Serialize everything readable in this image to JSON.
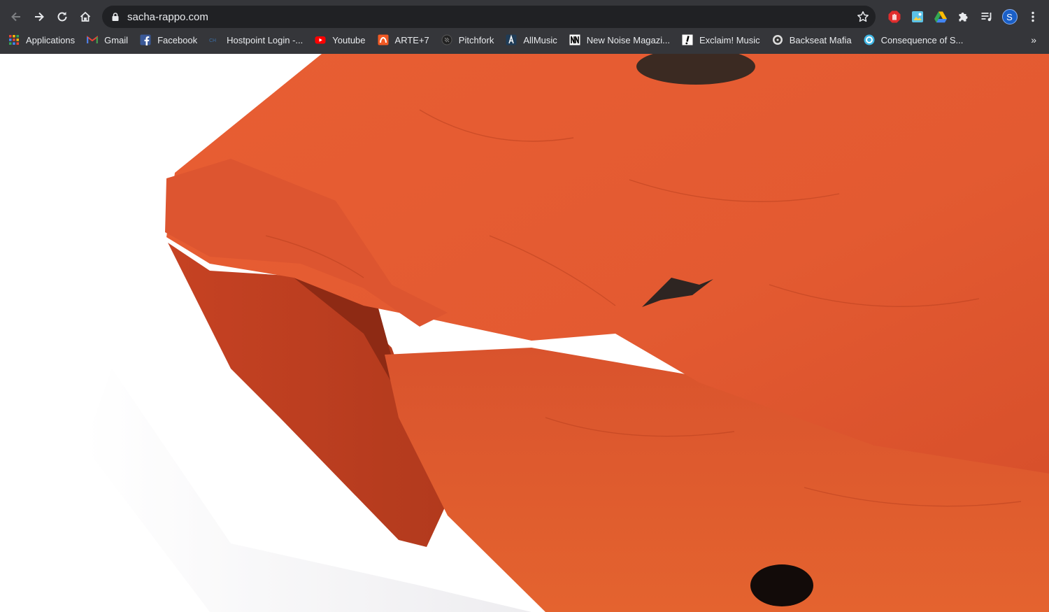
{
  "browser": {
    "address_bar": {
      "url": "sacha-rappo.com"
    },
    "profile_initial": "S"
  },
  "bookmarks": [
    {
      "label": "Applications",
      "icon": "apps-grid-icon"
    },
    {
      "label": "Gmail",
      "icon": "gmail-icon"
    },
    {
      "label": "Facebook",
      "icon": "facebook-icon"
    },
    {
      "label": "Hostpoint Login -...",
      "icon": "hostpoint-icon"
    },
    {
      "label": "Youtube",
      "icon": "youtube-icon"
    },
    {
      "label": "ARTE+7",
      "icon": "arte-icon"
    },
    {
      "label": "Pitchfork",
      "icon": "pitchfork-icon"
    },
    {
      "label": "AllMusic",
      "icon": "allmusic-icon"
    },
    {
      "label": "New Noise Magazi...",
      "icon": "new-noise-icon"
    },
    {
      "label": "Exclaim! Music",
      "icon": "exclaim-icon"
    },
    {
      "label": "Backseat Mafia",
      "icon": "backseat-mafia-icon"
    },
    {
      "label": "Consequence of S...",
      "icon": "consequence-icon"
    }
  ],
  "bookmarks_overflow": "»",
  "colors": {
    "chrome_bg": "#35363a",
    "omnibox_bg": "#202124",
    "sculpture_orange": "#e2552c",
    "sculpture_shadow": "#a93a1d"
  }
}
